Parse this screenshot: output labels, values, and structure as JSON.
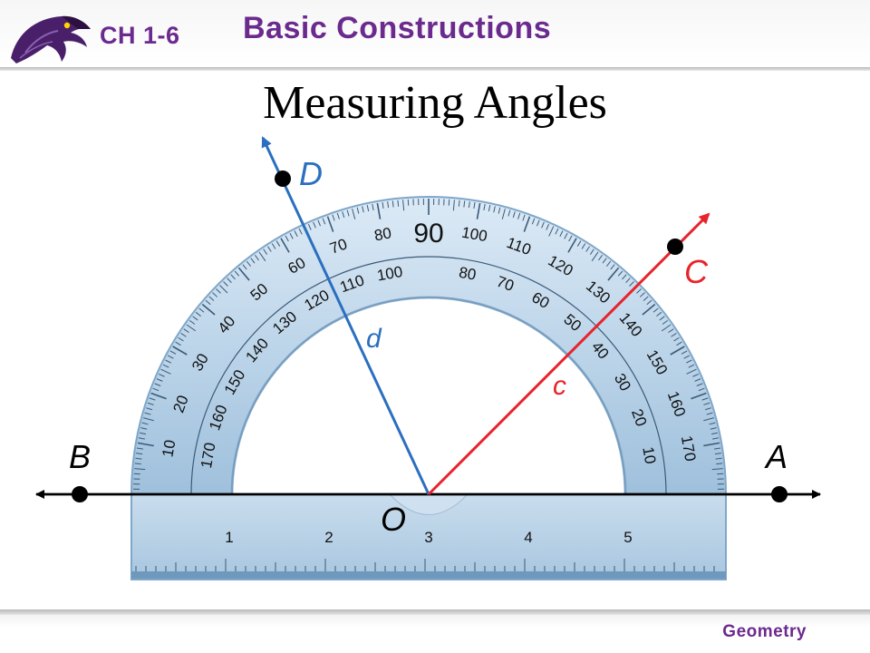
{
  "header": {
    "chapter": "CH 1-6",
    "title": "Basic Constructions",
    "logo_icon": "raven-mascot-icon"
  },
  "slide": {
    "title": "Measuring Angles"
  },
  "diagram": {
    "protractor_outer_scale": [
      "10",
      "20",
      "30",
      "40",
      "50",
      "60",
      "70",
      "80",
      "90",
      "100",
      "110",
      "120",
      "130",
      "140",
      "150",
      "160",
      "170"
    ],
    "protractor_inner_scale": [
      "170",
      "160",
      "150",
      "140",
      "130",
      "120",
      "110",
      "100",
      "80",
      "70",
      "60",
      "50",
      "40",
      "30",
      "20",
      "10"
    ],
    "ruler_numbers": [
      "1",
      "2",
      "3",
      "4",
      "5"
    ],
    "point_labels": {
      "A": "A",
      "B": "B",
      "C": "C",
      "D": "D",
      "O": "O"
    },
    "ray_labels": {
      "c": "c",
      "d": "d"
    },
    "colors": {
      "ray_c": "#e8232b",
      "ray_d": "#2a6fc0",
      "protractor": "#b9d3e8",
      "accent": "#6b2a8e"
    }
  },
  "footer": {
    "subject": "Geometry"
  }
}
